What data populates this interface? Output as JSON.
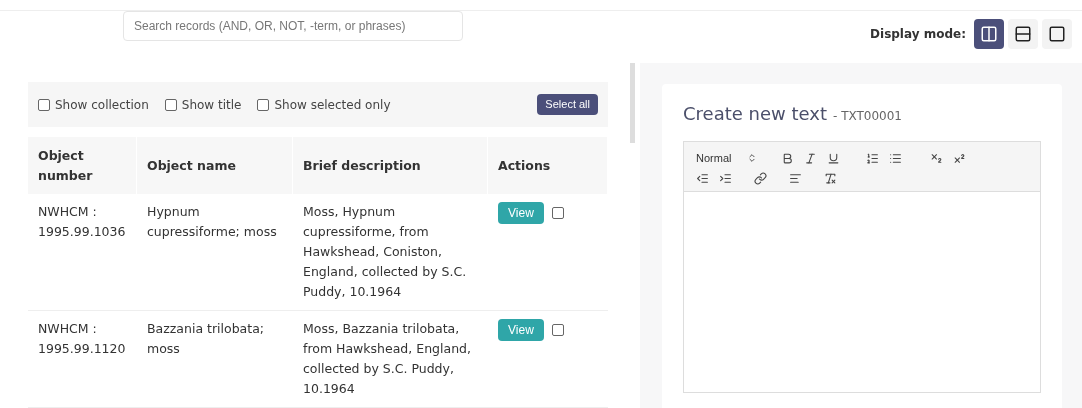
{
  "search": {
    "placeholder": "Search records (AND, OR, NOT, -term, or phrases)"
  },
  "display_mode": {
    "label": "Display mode:",
    "options": [
      {
        "kind": "columns",
        "selected": true
      },
      {
        "kind": "rows",
        "selected": false
      },
      {
        "kind": "single",
        "selected": false
      }
    ]
  },
  "filters": [
    {
      "label": "Show collection",
      "checked": false
    },
    {
      "label": "Show title",
      "checked": false
    },
    {
      "label": "Show selected only",
      "checked": false
    }
  ],
  "select_all": "Select all",
  "table": {
    "columns": [
      "Object number",
      "Object name",
      "Brief description",
      "Actions"
    ],
    "rows": [
      {
        "number": "NWHCM : 1995.99.1036",
        "name": "Hypnum cupressiforme; moss",
        "description": "Moss, Hypnum cupressiforme, from Hawkshead, Coniston, England, collected by S.C. Puddy, 10.1964",
        "action": "View",
        "selected": false
      },
      {
        "number": "NWHCM : 1995.99.1120",
        "name": "Bazzania trilobata; moss",
        "description": "Moss, Bazzania trilobata, from Hawkshead, England, collected by S.C. Puddy, 10.1964",
        "action": "View",
        "selected": false
      }
    ]
  },
  "editor": {
    "title": "Create new text",
    "code": "- TXT00001",
    "format": "Normal"
  }
}
